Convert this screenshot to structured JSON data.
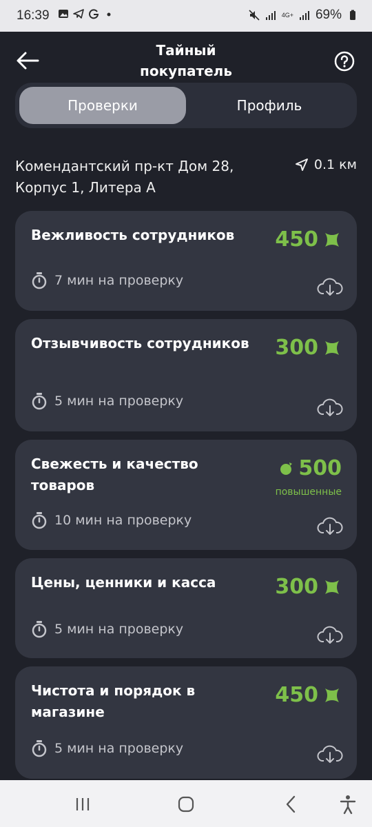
{
  "status_bar": {
    "time": "16:39",
    "battery": "69%",
    "network": "4G+",
    "icons": [
      "gallery-icon",
      "telegram-icon",
      "g-icon",
      "dot-icon",
      "mute-icon",
      "signal-icon",
      "signal-icon",
      "battery-icon"
    ]
  },
  "header": {
    "title_line1": "Тайный",
    "title_line2": "покупатель"
  },
  "tabs": [
    {
      "label": "Проверки",
      "active": true
    },
    {
      "label": "Профиль",
      "active": false
    }
  ],
  "address": {
    "line1": "Комендантский пр-кт Дом 28,",
    "line2": "Корпус 1, Литера А",
    "distance": "0.1 км"
  },
  "tasks": [
    {
      "title": "Вежливость сотрудников",
      "reward": "450",
      "reward_icon": "x-coin-icon",
      "duration": "7 мин на проверку"
    },
    {
      "title": "Отзывчивость сотрудников",
      "reward": "300",
      "reward_icon": "x-coin-icon",
      "duration": "5 мин на проверку"
    },
    {
      "title": "Свежесть и качество товаров",
      "reward": "500",
      "reward_icon": "boost-icon",
      "reward_note": "повышенные",
      "duration": "10 мин на проверку"
    },
    {
      "title": "Цены, ценники и касса",
      "reward": "300",
      "reward_icon": "x-coin-icon",
      "duration": "5 мин на проверку"
    },
    {
      "title": "Чистота и порядок в магазине",
      "reward": "450",
      "reward_icon": "x-coin-icon",
      "duration": "5 мин на проверку"
    }
  ],
  "colors": {
    "background": "#1f2129",
    "card": "#333641",
    "accent_green": "#7ec04a",
    "tab_active": "#9a9ca6"
  }
}
